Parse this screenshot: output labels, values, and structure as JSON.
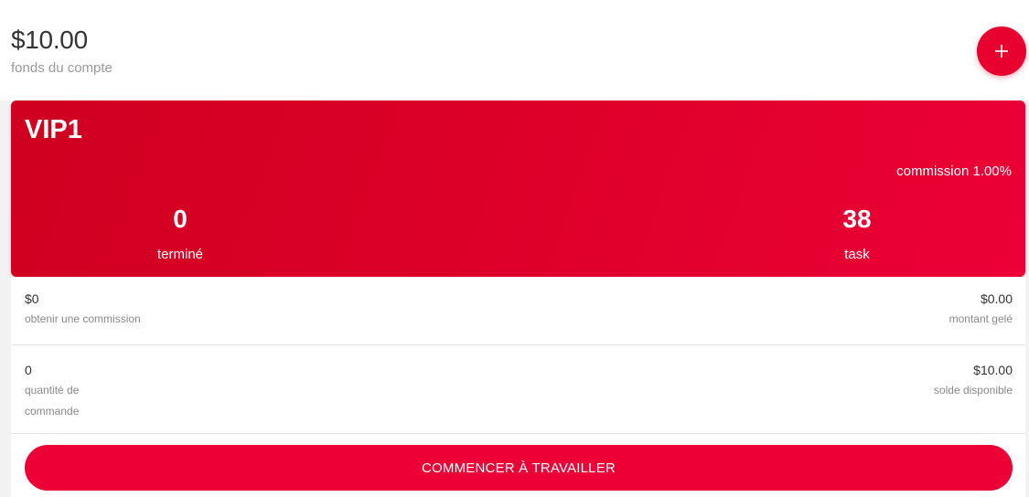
{
  "header": {
    "balance_amount": "$10.00",
    "balance_label": "fonds du compte",
    "add_button_icon": "plus-icon"
  },
  "vip_card": {
    "level": "VIP1",
    "commission": "commission 1.00%",
    "completed_value": "0",
    "completed_label": "terminé",
    "task_value": "38",
    "task_label": "task"
  },
  "details": {
    "commission_value": "$0",
    "commission_label": "obtenir une commission",
    "frozen_value": "$0.00",
    "frozen_label": "montant gelé",
    "orders_value": "0",
    "orders_label": "quantité de commande",
    "available_value": "$10.00",
    "available_label": "solde disponible"
  },
  "actions": {
    "start_label": "COMMENCER À TRAVAILLER"
  },
  "colors": {
    "accent": "#e8002f",
    "card_gradient_start": "#cf0020",
    "card_gradient_end": "#ec0036"
  }
}
